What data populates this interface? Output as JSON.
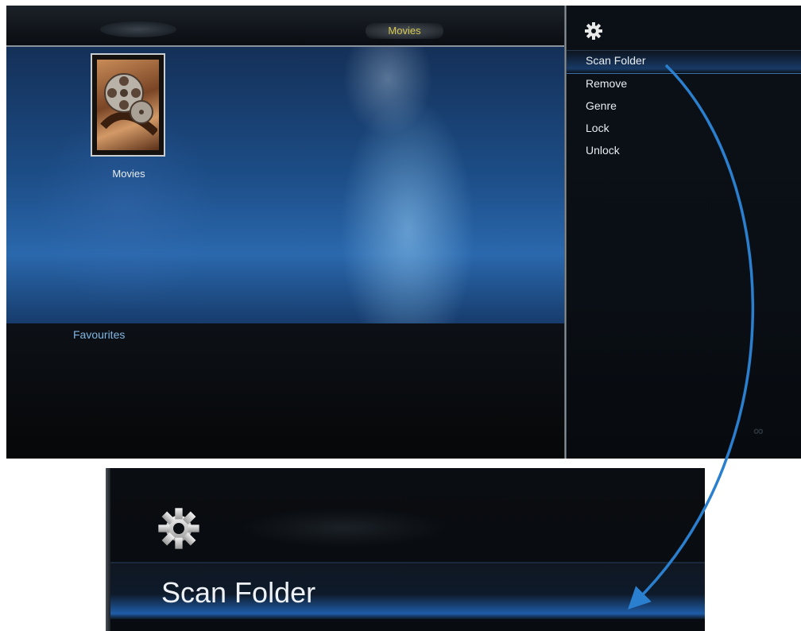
{
  "header": {
    "title": "Movies"
  },
  "tiles": [
    {
      "label": "Movies"
    }
  ],
  "sections": {
    "favourites_label": "Favourites"
  },
  "side_menu": {
    "icon": "gear-icon",
    "items": [
      {
        "label": "Scan Folder",
        "selected": true
      },
      {
        "label": "Remove"
      },
      {
        "label": "Genre"
      },
      {
        "label": "Lock"
      },
      {
        "label": "Unlock"
      }
    ]
  },
  "callout": {
    "label": "Scan Folder",
    "icon": "gear-icon"
  },
  "colors": {
    "title_text": "#d7c84f",
    "favourites_text": "#7fb6e3",
    "selection_highlight": "#2e72c4",
    "arrow": "#2a7fcf"
  }
}
